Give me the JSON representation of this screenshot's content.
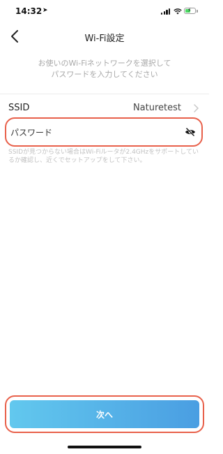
{
  "status_bar": {
    "time": "14:32",
    "location_icon": "location-arrow-icon",
    "battery_level": 0.55,
    "battery_charging": true
  },
  "nav": {
    "title": "Wi-Fi設定",
    "back_icon": "chevron-left-icon"
  },
  "description": "お使いのWi-Fiネットワークを選択して\nパスワードを入力してください",
  "ssid": {
    "label": "SSID",
    "value": "Naturetest"
  },
  "password": {
    "placeholder": "パスワード",
    "value": "",
    "toggle_icon": "eye-slash-icon"
  },
  "hint": "SSIDが見つからない場合はWi-Fiルータが2.4GHzをサポートしているか確認し、近くでセットアップをして下さい。",
  "next_button": {
    "label": "次へ"
  },
  "colors": {
    "accent_gradient_start": "#62c8ee",
    "accent_gradient_end": "#4a9ee2",
    "highlight": "#e8604a"
  }
}
